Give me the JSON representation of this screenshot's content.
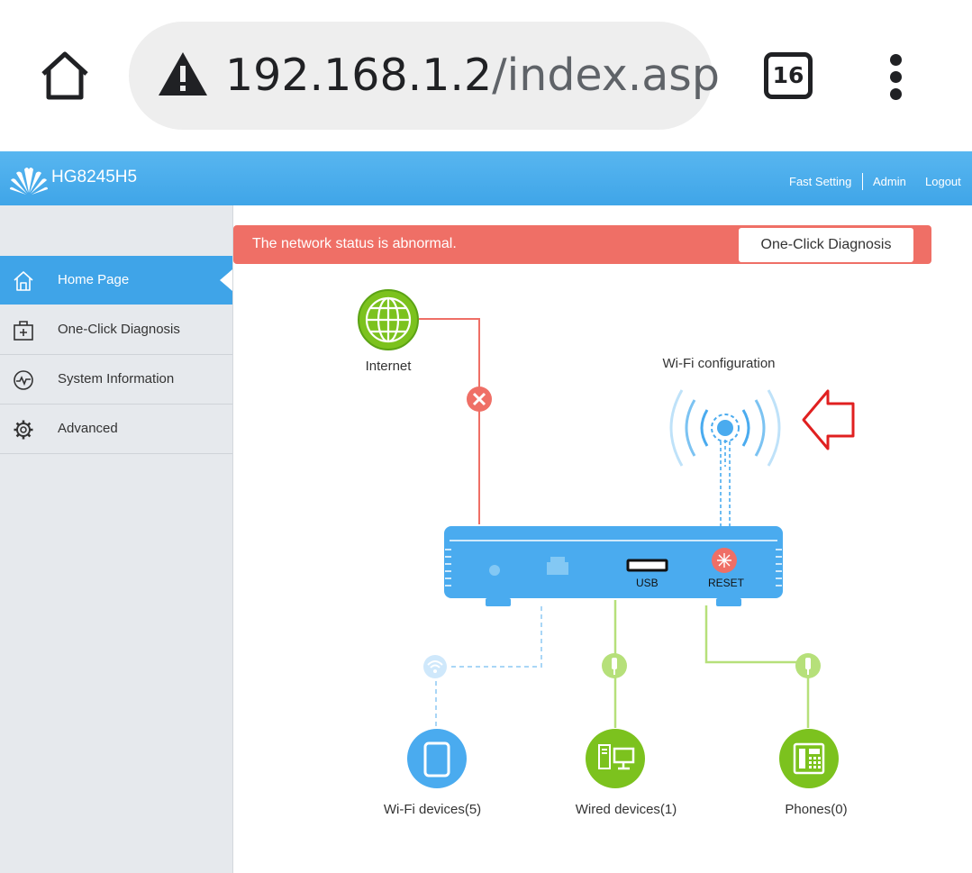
{
  "browser": {
    "url_host": "192.168.1.2",
    "url_path": "/index.asp",
    "tab_count": "16",
    "home_icon": "home-icon",
    "security_icon": "warning-icon",
    "menu_icon": "more-vert-icon"
  },
  "header": {
    "model": "HG8245H5",
    "logo": "huawei-logo",
    "links": [
      "Fast Setting",
      "Admin",
      "Logout"
    ]
  },
  "sidebar": {
    "items": [
      {
        "label": "Home Page",
        "icon": "home-icon",
        "active": true
      },
      {
        "label": "One-Click Diagnosis",
        "icon": "medkit-icon",
        "active": false
      },
      {
        "label": "System Information",
        "icon": "pulse-icon",
        "active": false
      },
      {
        "label": "Advanced",
        "icon": "gear-icon",
        "active": false
      }
    ]
  },
  "alert": {
    "message": "The network status is abnormal.",
    "button": "One-Click Diagnosis"
  },
  "topology": {
    "internet_label": "Internet",
    "internet_status": "disconnected",
    "wifi_config_label": "Wi-Fi configuration",
    "usb_label": "USB",
    "reset_label": "RESET",
    "wifi_devices_label": "Wi-Fi devices(5)",
    "wired_devices_label": "Wired devices(1)",
    "phones_label": "Phones(0)"
  },
  "colors": {
    "brand_blue": "#3fa4e8",
    "alert_red": "#ef6f66",
    "internet_green": "#7cc21e",
    "device_green": "#8bc925",
    "wifi_blue": "#4aabef",
    "arrow_red": "#e02020"
  }
}
